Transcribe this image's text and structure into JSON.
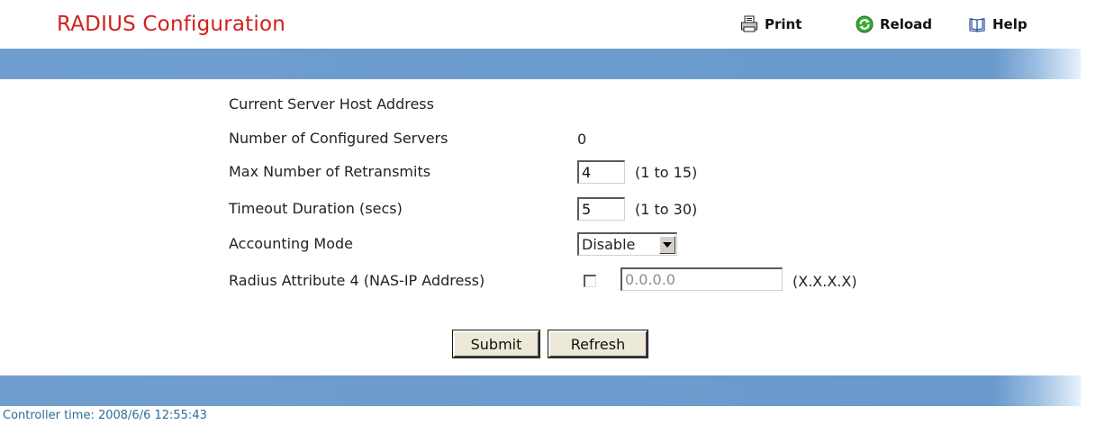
{
  "page": {
    "title": "RADIUS Configuration"
  },
  "toolbar": {
    "print_label": "Print",
    "reload_label": "Reload",
    "help_label": "Help",
    "print_icon": "printer-icon",
    "reload_icon": "reload-icon",
    "help_icon": "help-book-icon"
  },
  "form": {
    "current_server_label": "Current Server Host Address",
    "current_server_value": "",
    "num_servers_label": "Number of Configured Servers",
    "num_servers_value": "0",
    "max_retransmits_label": "Max Number of Retransmits",
    "max_retransmits_value": "4",
    "max_retransmits_range": "(1 to 15)",
    "timeout_label": "Timeout Duration (secs)",
    "timeout_value": "5",
    "timeout_range": "(1 to 30)",
    "accounting_label": "Accounting Mode",
    "accounting_selected": "Disable",
    "nas_ip_label": "Radius Attribute 4 (NAS-IP Address)",
    "nas_ip_checked": false,
    "nas_ip_value": "0.0.0.0",
    "nas_ip_format": "(X.X.X.X)"
  },
  "buttons": {
    "submit_label": "Submit",
    "refresh_label": "Refresh"
  },
  "footer": {
    "controller_time": "Controller time: 2008/6/6 12:55:43"
  },
  "colors": {
    "title": "#d31f1f",
    "band": "#6a9acc",
    "footer_text": "#2a6f95"
  }
}
